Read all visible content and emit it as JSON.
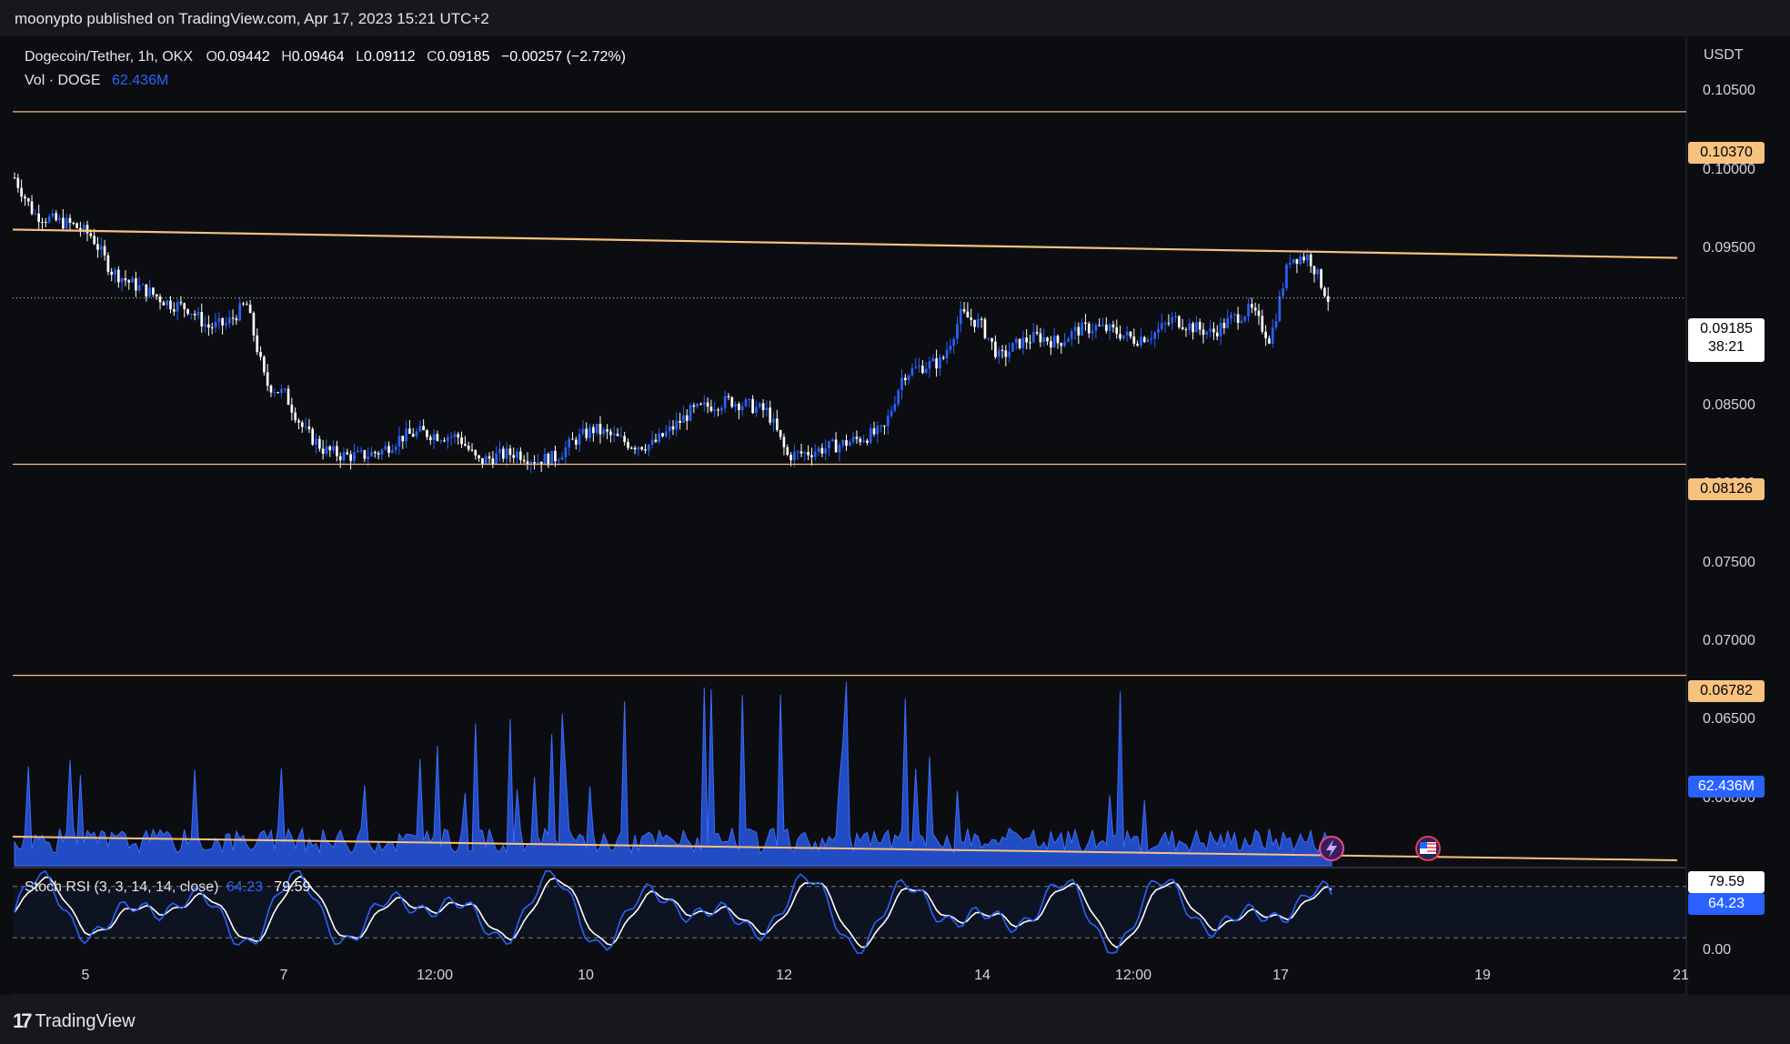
{
  "header": {
    "publisher_line": "moonypto published on TradingView.com, Apr 17, 2023 15:21 UTC+2"
  },
  "legend": {
    "symbol": "Dogecoin/Tether, 1h, OKX",
    "o_label": "O",
    "o_value": "0.09442",
    "h_label": "H",
    "h_value": "0.09464",
    "l_label": "L",
    "l_value": "0.09112",
    "c_label": "C",
    "c_value": "0.09185",
    "change": "−0.00257 (−2.72%)",
    "vol_label": "Vol · DOGE",
    "vol_value": "62.436M"
  },
  "stoch_legend": {
    "label": "Stoch RSI (3, 3, 14, 14, close)",
    "k_value": "64.23",
    "d_value": "79.59"
  },
  "price_axis": {
    "currency": "USDT",
    "ticks": [
      "0.10500",
      "0.10000",
      "0.09500",
      "0.08500",
      "0.08000",
      "0.07500",
      "0.07000",
      "0.06500",
      "0.06000"
    ],
    "levels": [
      "0.10370",
      "0.08126",
      "0.06782"
    ],
    "current_price": "0.09185",
    "countdown": "38:21",
    "volume_badge": "62.436M"
  },
  "stoch_axis": {
    "ticks": [
      "0.00"
    ],
    "d_badge": "79.59",
    "k_badge": "64.23"
  },
  "time_axis": [
    "5",
    "7",
    "12:00",
    "10",
    "12",
    "14",
    "12:00",
    "17",
    "19",
    "21"
  ],
  "footer": {
    "logo_text": "TradingView",
    "logo_mark": "17"
  },
  "colors": {
    "background": "#0c0d10",
    "up_candle": "#2962ff",
    "down_candle": "#ffffff",
    "level_line": "#f7c17e",
    "volume": "#2962ff",
    "stoch_k": "#2962ff",
    "stoch_d": "#ffffff"
  },
  "icons": [
    "lightning-event-icon",
    "us-flag-event-icon"
  ],
  "chart_data": {
    "type": "candlestick",
    "symbol": "Dogecoin/Tether",
    "interval": "1h",
    "exchange": "OKX",
    "y_unit": "USDT",
    "ylim": [
      0.0557,
      0.1085
    ],
    "x_tick_labels": [
      "5",
      "7",
      "12:00",
      "10",
      "12",
      "14",
      "12:00",
      "17",
      "19",
      "21"
    ],
    "horizontal_levels": [
      0.1037,
      0.08126,
      0.06782
    ],
    "descending_trendline": {
      "start": 0.0962,
      "end": 0.0944
    },
    "last_candle": {
      "open": 0.09442,
      "high": 0.09464,
      "low": 0.09112,
      "close": 0.09185,
      "change": -0.00257,
      "change_pct": -2.72
    },
    "close_path_approx": [
      0.0995,
      0.0972,
      0.0968,
      0.0965,
      0.0958,
      0.0936,
      0.0928,
      0.0922,
      0.0915,
      0.0912,
      0.09,
      0.0902,
      0.0915,
      0.0864,
      0.0857,
      0.0834,
      0.0822,
      0.0818,
      0.0818,
      0.0821,
      0.083,
      0.0833,
      0.0831,
      0.083,
      0.0814,
      0.0818,
      0.082,
      0.0815,
      0.0817,
      0.0828,
      0.0835,
      0.083,
      0.0825,
      0.0825,
      0.0835,
      0.0846,
      0.085,
      0.0853,
      0.085,
      0.0846,
      0.0818,
      0.082,
      0.0823,
      0.0826,
      0.083,
      0.0834,
      0.087,
      0.0875,
      0.0878,
      0.0908,
      0.0902,
      0.088,
      0.089,
      0.0894,
      0.089,
      0.0898,
      0.09,
      0.0897,
      0.0892,
      0.0896,
      0.0905,
      0.09,
      0.0896,
      0.0905,
      0.0911,
      0.0892,
      0.0944,
      0.0945,
      0.0918
    ],
    "volume": {
      "unit": "DOGE",
      "last": 62.436
    },
    "stoch_rsi": {
      "params": "3, 3, 14, 14, close",
      "k": 64.23,
      "d": 79.59,
      "ylim": [
        0,
        100
      ],
      "bands": [
        20,
        80
      ]
    }
  }
}
